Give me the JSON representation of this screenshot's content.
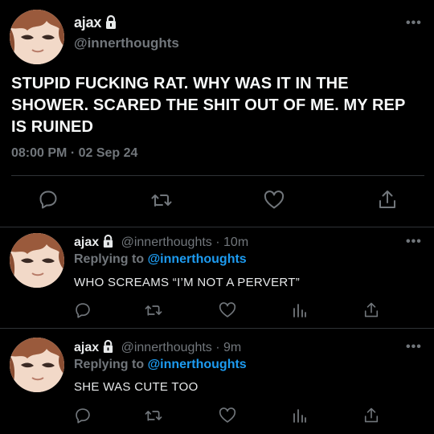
{
  "main_tweet": {
    "name": "ajax",
    "handle": "@innerthoughts",
    "text": "STUPID FUCKING RAT. WHY WAS IT IN THE SHOWER. SCARED THE SHIT OUT OF ME. MY REP IS RUINED",
    "timestamp": "08:00 PM · 02 Sep 24",
    "more_label": "•••",
    "actions": [
      "reply-icon",
      "retweet-icon",
      "like-icon",
      "share-icon"
    ]
  },
  "replies": [
    {
      "name": "ajax",
      "handle": "@innerthoughts",
      "time": "· 10m",
      "replying_prefix": "Replying to",
      "replying_to": "@innerthoughts",
      "text": "WHO SCREAMS “I’M NOT A PERVERT”",
      "more_label": "•••",
      "actions": [
        "reply-icon",
        "retweet-icon",
        "like-icon",
        "analytics-icon",
        "share-icon"
      ]
    },
    {
      "name": "ajax",
      "handle": "@innerthoughts",
      "time": "· 9m",
      "replying_prefix": "Replying to",
      "replying_to": "@innerthoughts",
      "text": "SHE WAS CUTE TOO",
      "more_label": "•••",
      "actions": [
        "reply-icon",
        "retweet-icon",
        "like-icon",
        "analytics-icon",
        "share-icon"
      ]
    }
  ],
  "colors": {
    "background": "#000000",
    "text": "#e7e9ea",
    "secondary": "#71767b",
    "accent": "#1d9bf0",
    "divider": "#2f3336"
  }
}
